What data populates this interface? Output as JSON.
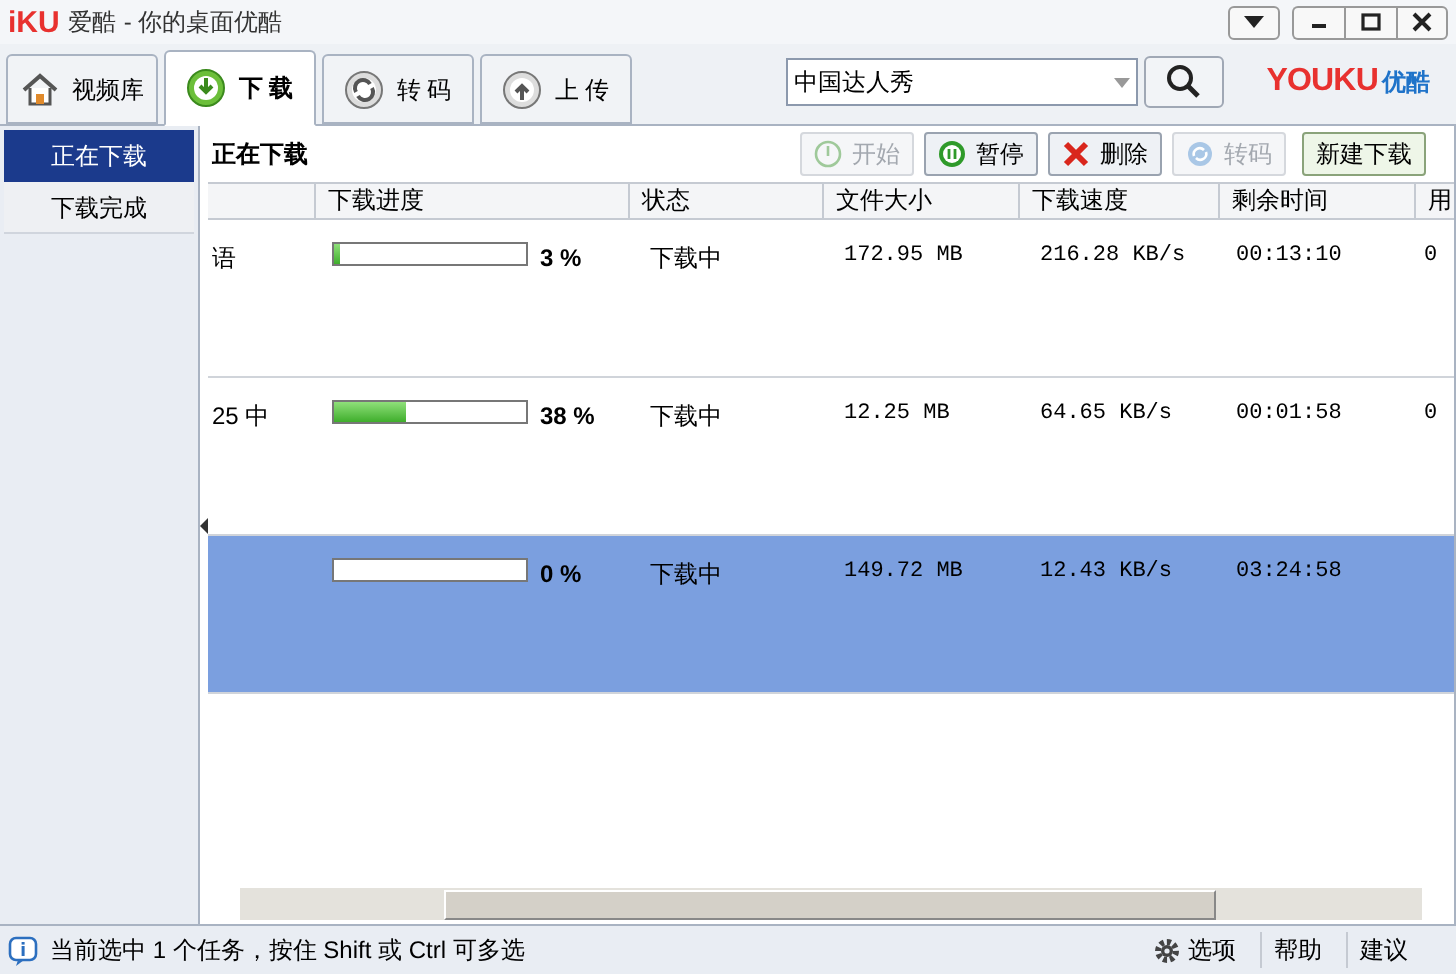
{
  "window": {
    "logo": "iKU",
    "title": "爱酷",
    "subtitle": "- 你的桌面优酷"
  },
  "tabs": [
    {
      "label": "视频库",
      "kind": "home",
      "selected": false
    },
    {
      "label": "下 载",
      "kind": "download",
      "selected": true
    },
    {
      "label": "转 码",
      "kind": "convert",
      "selected": false
    },
    {
      "label": "上 传",
      "kind": "upload",
      "selected": false
    }
  ],
  "search": {
    "value": "中国达人秀"
  },
  "brand": {
    "logo": "YOUKU",
    "name": "优酷"
  },
  "sidebar": {
    "items": [
      {
        "label": "正在下载",
        "selected": true
      },
      {
        "label": "下载完成",
        "selected": false
      }
    ]
  },
  "panel_title": "正在下载",
  "toolbar": [
    {
      "label": "开始",
      "kind": "start",
      "disabled": true
    },
    {
      "label": "暂停",
      "kind": "pause",
      "disabled": false
    },
    {
      "label": "删除",
      "kind": "delete",
      "disabled": false
    },
    {
      "label": "转码",
      "kind": "convert",
      "disabled": true
    },
    {
      "label": "新建下载",
      "kind": "new",
      "disabled": false
    }
  ],
  "table": {
    "columns": [
      "下载进度",
      "状态",
      "文件大小",
      "下载速度",
      "剩余时间",
      "用"
    ],
    "rows": [
      {
        "name": "语",
        "level": 0.03,
        "percent": "3 %",
        "status": "下载中",
        "size": "172.95 MB",
        "speed": "216.28 KB/s",
        "remaining": "00:13:10",
        "column_7": "0",
        "selected": false
      },
      {
        "name": "25 中",
        "level": 0.38,
        "percent": "38 %",
        "status": "下载中",
        "size": "12.25 MB",
        "speed": "64.65 KB/s",
        "remaining": "00:01:58",
        "column_7": "0",
        "selected": false
      },
      {
        "level": 0,
        "percent": "0 %",
        "status": "下载中",
        "size": "149.72 MB",
        "speed": "12.43 KB/s",
        "remaining": "03:24:58",
        "selected": true
      }
    ]
  },
  "status_bar": {
    "message": "当前选中 1 个任务，按住 Shift 或 Ctrl 可多选",
    "links": [
      "选项",
      "帮助",
      "建议"
    ]
  }
}
